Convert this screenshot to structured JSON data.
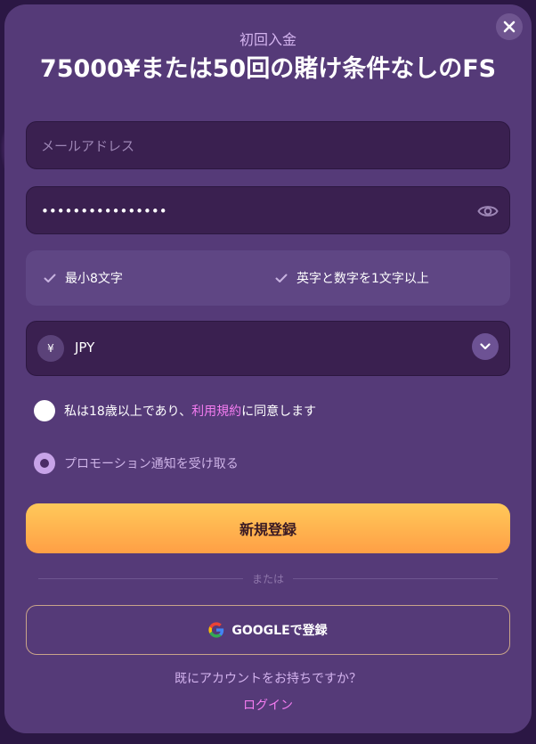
{
  "header": {
    "subtitle": "初回入金",
    "headline": "75000¥または50回の賭け条件なしのFS"
  },
  "form": {
    "email_placeholder": "メールアドレス",
    "password_value": "••••••••••••••••",
    "requirements": [
      {
        "label": "最小8文字"
      },
      {
        "label": "英字と数字を1文字以上"
      }
    ],
    "currency": {
      "symbol": "¥",
      "code": "JPY"
    },
    "age_agree": {
      "prefix": "私は18歳以上であり、",
      "link": "利用規約",
      "suffix": "に同意します"
    },
    "promo_label": "プロモーション通知を受け取る",
    "register_label": "新規登録",
    "or_label": "または",
    "google_label": "GOOGLEで登録",
    "have_account": "既にアカウントをお持ちですか？",
    "login_label": "ログイン"
  },
  "icons": {
    "close": "close-icon",
    "eye": "eye-icon",
    "check": "check-icon",
    "chevron": "chevron-down-icon",
    "google": "google-icon"
  },
  "colors": {
    "modal_bg": "#553a78",
    "accent_link": "#f37cf0",
    "button_gradient_top": "#ffc95a",
    "button_gradient_bottom": "#ff9f45"
  }
}
